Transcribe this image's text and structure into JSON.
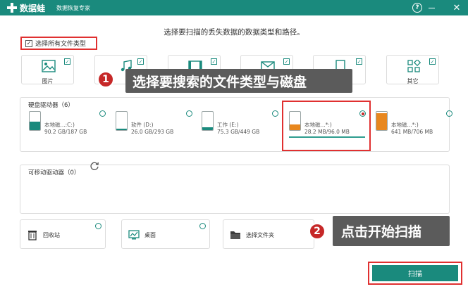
{
  "titlebar": {
    "app_name": "数据蛙",
    "app_subtitle": "数据恢复专家",
    "help_label": "?",
    "close_label": "✕"
  },
  "heading": "选择要扫描的丢失数据的数据类型和路径。",
  "select_all": {
    "label": "选择所有文件类型",
    "checked": true,
    "check_glyph": "✓"
  },
  "file_types": [
    {
      "label": "图片",
      "icon": "image-icon",
      "checked": true
    },
    {
      "label": "",
      "icon": "audio-icon",
      "checked": true
    },
    {
      "label": "",
      "icon": "video-icon",
      "checked": true
    },
    {
      "label": "",
      "icon": "email-icon",
      "checked": true
    },
    {
      "label": "",
      "icon": "document-icon",
      "checked": true
    },
    {
      "label": "其它",
      "icon": "other-icon",
      "checked": true
    }
  ],
  "callouts": {
    "step1_number": "1",
    "step1_text": "选择要搜索的文件类型与磁盘",
    "step2_number": "2",
    "step2_text": "点击开始扫描"
  },
  "hard_drives": {
    "title": "硬盘驱动器（6）",
    "items": [
      {
        "name": "本地磁...:C:)",
        "size": "90.2 GB/187 GB",
        "selected": false,
        "used_fraction": 0.48,
        "color": "#1a8a7d"
      },
      {
        "name": "软件 (D:)",
        "size": "26.0 GB/293 GB",
        "selected": false,
        "used_fraction": 0.09,
        "color": "#1a8a7d"
      },
      {
        "name": "工作 (E:)",
        "size": "75.3 GB/449 GB",
        "selected": false,
        "used_fraction": 0.17,
        "color": "#1a8a7d"
      },
      {
        "name": "本地磁...*:)",
        "size": "28.2 MB/96.0 MB",
        "selected": true,
        "used_fraction": 0.29,
        "color": "#e8871e"
      },
      {
        "name": "本地磁...*:)",
        "size": "641 MB/706 MB",
        "selected": false,
        "used_fraction": 0.91,
        "color": "#e8871e"
      }
    ]
  },
  "removable_drives": {
    "title": "可移动驱动器（0）"
  },
  "locations": [
    {
      "label": "回收站",
      "icon": "recycle-bin-icon"
    },
    {
      "label": "桌面",
      "icon": "desktop-icon"
    },
    {
      "label": "选择文件夹",
      "icon": "folder-icon"
    }
  ],
  "scan_button": "扫描",
  "colors": {
    "brand": "#1a8a7d",
    "highlight": "#e03030",
    "callout_bg": "#5b5b5b",
    "badge": "#c62828",
    "removable_drive": "#e8871e"
  }
}
